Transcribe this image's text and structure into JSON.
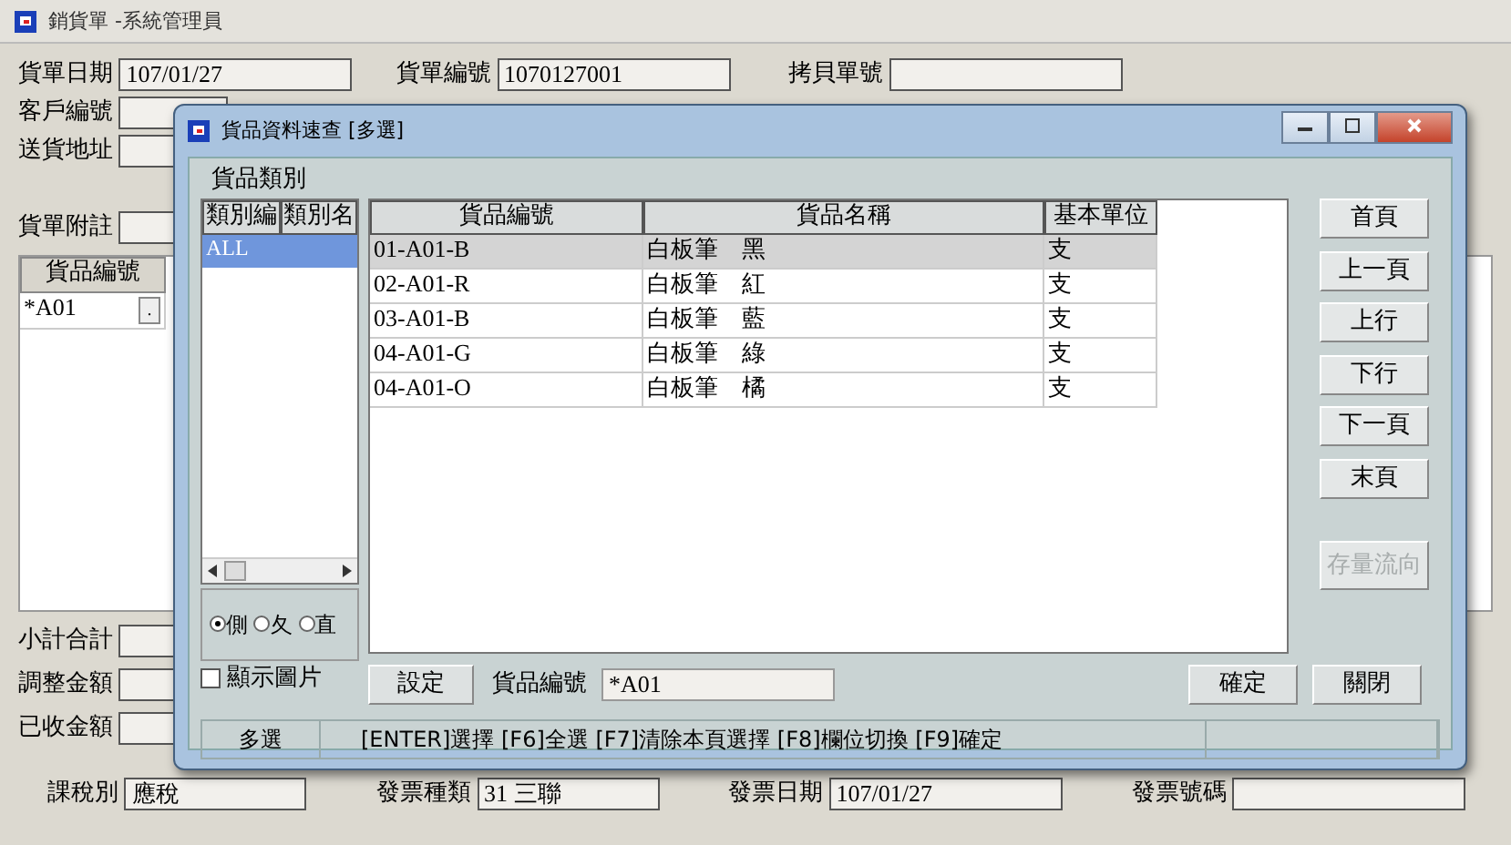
{
  "window": {
    "title": "銷貨單 -系統管理員"
  },
  "top_fields": [
    {
      "label": "貨單日期",
      "value": "107/01/27"
    },
    {
      "label": "貨單編號",
      "value": "1070127001"
    },
    {
      "label": "拷貝單號"
    }
  ],
  "left_fields": [
    {
      "label": "客戶編號"
    },
    {
      "label": "送貨地址"
    },
    {
      "label": "貨單附註"
    }
  ],
  "items_grid": {
    "columns": [
      "貨品編號"
    ],
    "rows": [
      {
        "code": "*A01",
        "browse": "."
      }
    ]
  },
  "totals": [
    {
      "label": "小計合計"
    },
    {
      "label": "調整金額"
    },
    {
      "label": "已收金額"
    }
  ],
  "footer_fields": [
    {
      "label": "課稅別",
      "value": "應稅"
    },
    {
      "label": "發票種類",
      "value": "31 三聯"
    },
    {
      "label": "發票日期",
      "value": "107/01/27"
    },
    {
      "label": "發票號碼"
    }
  ],
  "dialog": {
    "title": "貨品資料速查 [多選]",
    "category_label": "貨品類別",
    "category_columns": [
      "類別編",
      "類別名"
    ],
    "categories": [
      {
        "code": "ALL",
        "selected": true
      }
    ],
    "radios": [
      {
        "label": "側",
        "selected": true
      },
      {
        "label": "夂",
        "selected": false
      },
      {
        "label": "直",
        "selected": false
      }
    ],
    "show_images": {
      "label": "顯示圖片",
      "checked": false
    },
    "product_columns": [
      "貨品編號",
      "貨品名稱",
      "基本單位"
    ],
    "products": [
      {
        "code": "01-A01-B",
        "name": "白板筆　黑",
        "unit": "支",
        "selected": true
      },
      {
        "code": "02-A01-R",
        "name": "白板筆　紅",
        "unit": "支",
        "selected": false
      },
      {
        "code": "03-A01-B",
        "name": "白板筆　藍",
        "unit": "支",
        "selected": false
      },
      {
        "code": "04-A01-G",
        "name": "白板筆　綠",
        "unit": "支",
        "selected": false
      },
      {
        "code": "04-A01-O",
        "name": "白板筆　橘",
        "unit": "支",
        "selected": false
      }
    ],
    "nav_buttons": [
      {
        "label": "首頁",
        "disabled": false
      },
      {
        "label": "上一頁",
        "disabled": false
      },
      {
        "label": "上行",
        "disabled": false
      },
      {
        "label": "下行",
        "disabled": false
      },
      {
        "label": "下一頁",
        "disabled": false
      },
      {
        "label": "末頁",
        "disabled": false
      },
      {
        "label": "存量流向",
        "disabled": true
      }
    ],
    "settings_button": "設定",
    "code_label": "貨品編號",
    "code_value": "*A01",
    "ok_button": "確定",
    "close_button": "關閉",
    "status_bar": [
      "多選",
      "[ENTER]選擇 [F6]全選 [F7]清除本頁選擇 [F8]欄位切換 [F9]確定"
    ]
  }
}
